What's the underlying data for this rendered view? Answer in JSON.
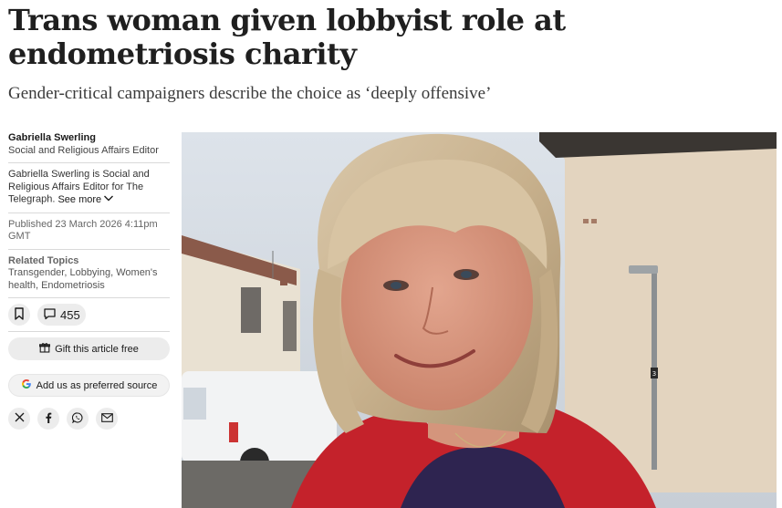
{
  "article": {
    "headline": "Trans woman given lobbyist role at endometriosis charity",
    "standfirst": "Gender-critical campaigners describe the choice as ‘deeply offensive’"
  },
  "author": {
    "name": "Gabriella Swerling",
    "role": "Social and Religious Affairs Editor",
    "bio": "Gabriella Swerling is Social and Religious Affairs Editor for The Telegraph.",
    "see_more": "See more"
  },
  "meta": {
    "published": "Published 23 March 2026 4:11pm GMT",
    "related_title": "Related Topics",
    "related_topics": "Transgender, Lobbying, Women's health, Endometriosis"
  },
  "actions": {
    "comment_count": "455",
    "gift_label": "Gift this article free",
    "preferred_source_label": "Add us as preferred source"
  },
  "share": {
    "items": [
      "x-icon",
      "facebook-icon",
      "whatsapp-icon",
      "email-icon"
    ]
  },
  "photo": {
    "house_number": "3"
  },
  "colors": {
    "button_bg": "#ececec",
    "jumper_red": "#c4222b"
  }
}
